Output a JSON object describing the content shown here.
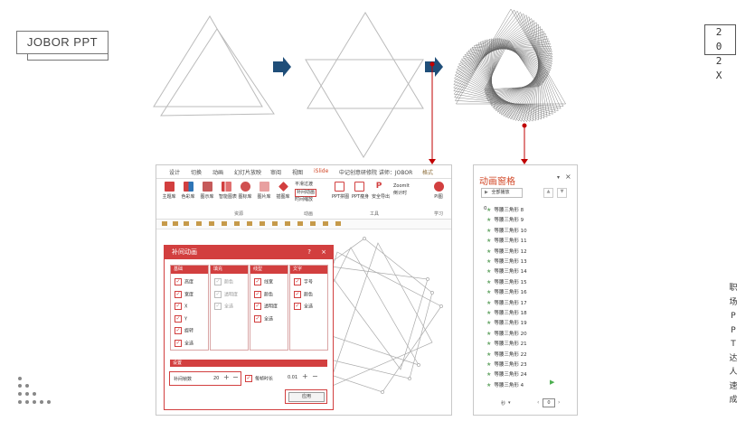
{
  "logo": {
    "text": "JOBOR PPT"
  },
  "year": {
    "line1": "2 0",
    "line2": "2 X"
  },
  "side_text": [
    "职",
    "场",
    "P",
    "P",
    "T",
    "达",
    "人",
    "速",
    "成"
  ],
  "colors": {
    "accent": "#d23f3f",
    "arrow": "#1f4e79",
    "pointer": "#c00000"
  },
  "ppt": {
    "tabs": [
      "设计",
      "切换",
      "动画",
      "幻灯片放映",
      "审阅",
      "视图",
      "iSlide",
      "中记创意研修院 讲师：JOBOR",
      "格式"
    ],
    "ribbon_buttons": [
      "主题库",
      "色彩库",
      "图示库",
      "智能图表",
      "图标库",
      "图片库",
      "插图库",
      "PPT拼图",
      "PPT瘦身",
      "安全导出",
      "PI图"
    ],
    "ribbon_small": [
      "平滑过渡",
      "补间动画",
      "时间缩放",
      "ZoomIt",
      "倒计时"
    ],
    "groups": [
      "资源",
      "动画",
      "工具",
      "学习"
    ]
  },
  "dialog": {
    "title": "补间动画",
    "help": "?",
    "close": "×",
    "columns": [
      {
        "title": "基础",
        "items": [
          "高度",
          "宽度",
          "X",
          "Y",
          "旋转",
          "全选"
        ],
        "dim": false
      },
      {
        "title": "填充",
        "items": [
          "颜色",
          "透明度",
          "全选"
        ],
        "dim": true
      },
      {
        "title": "线型",
        "items": [
          "线宽",
          "颜色",
          "透明度",
          "全选"
        ],
        "dim": false
      },
      {
        "title": "文字",
        "items": [
          "字号",
          "颜色",
          "全选"
        ],
        "dim": false
      }
    ],
    "settings_title": "设置",
    "frames_label": "补间帧数",
    "frames_value": "20",
    "duration_label": "每帧时长",
    "duration_value": "0.01",
    "apply": "应用"
  },
  "pane": {
    "title": "动画窗格",
    "play_all": "全部播放",
    "first_index": "0",
    "items": [
      "等腰三角形 8",
      "等腰三角形 9",
      "等腰三角形 10",
      "等腰三角形 11",
      "等腰三角形 12",
      "等腰三角形 13",
      "等腰三角形 14",
      "等腰三角形 15",
      "等腰三角形 16",
      "等腰三角形 17",
      "等腰三角形 18",
      "等腰三角形 19",
      "等腰三角形 20",
      "等腰三角形 21",
      "等腰三角形 22",
      "等腰三角形 23",
      "等腰三角形 24",
      "等腰三角形 4"
    ],
    "seconds_label": "秒",
    "page_value": "0"
  }
}
